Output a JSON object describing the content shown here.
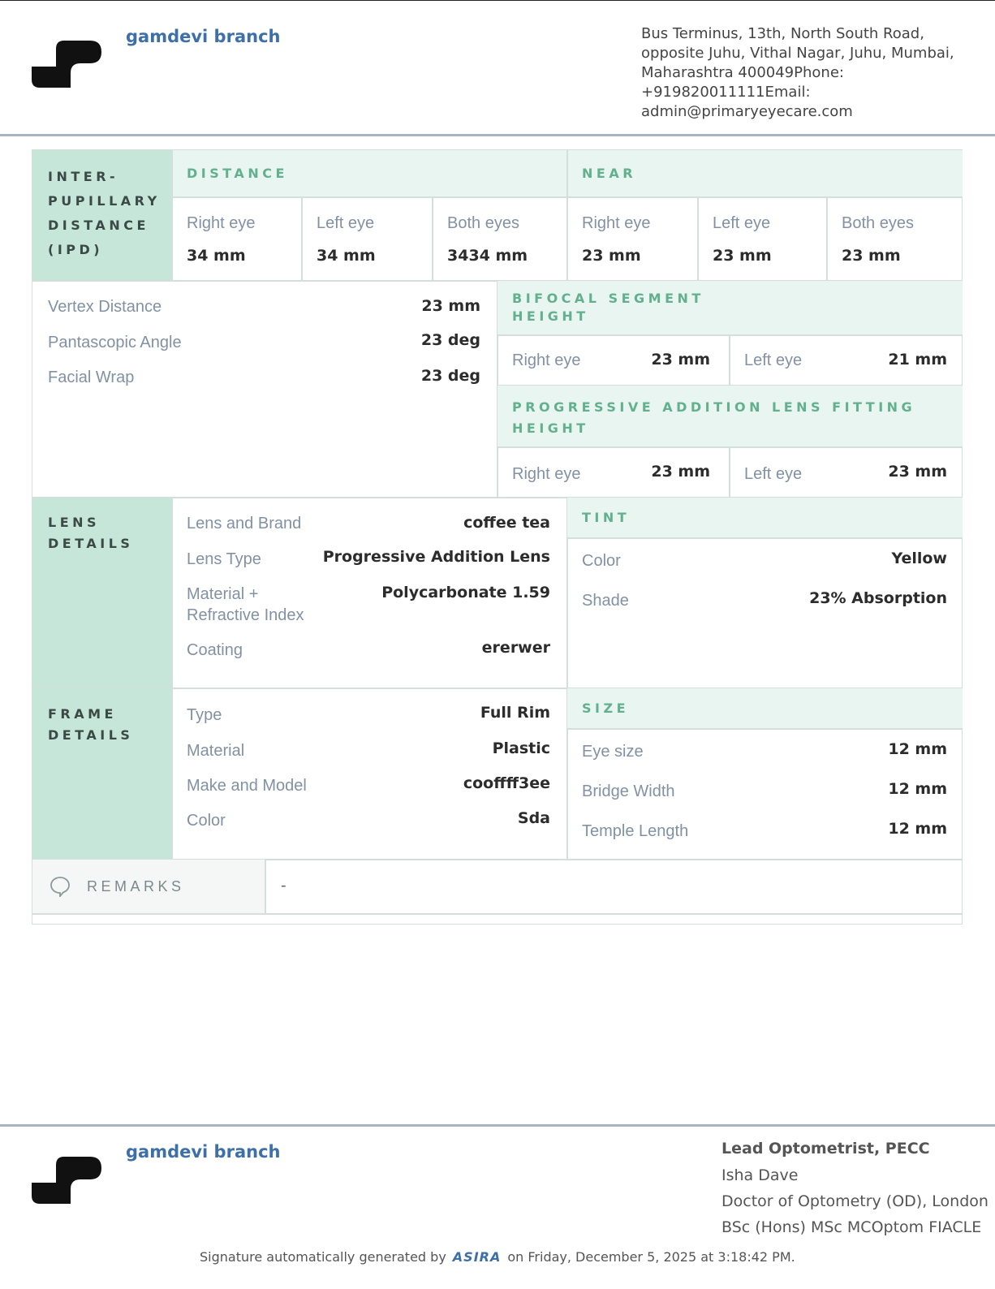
{
  "header": {
    "branch": "gamdevi branch",
    "address": "Bus Terminus, 13th, North South Road, opposite Juhu, Vithal Nagar, Juhu, Mumbai, Maharashtra 400049Phone: +919820011111Email: admin@primaryeyecare.com"
  },
  "ipd": {
    "title": "INTER-PUPILLARY DISTANCE (IPD)",
    "distance_title": "DISTANCE",
    "near_title": "NEAR",
    "distance": [
      {
        "label": "Right eye",
        "value": "34 mm"
      },
      {
        "label": "Left eye",
        "value": "34 mm"
      },
      {
        "label": "Both eyes",
        "value": "3434 mm"
      }
    ],
    "near": [
      {
        "label": "Right eye",
        "value": "23 mm"
      },
      {
        "label": "Left eye",
        "value": "23 mm"
      },
      {
        "label": "Both eyes",
        "value": "23 mm"
      }
    ]
  },
  "measurements": [
    {
      "label": "Vertex Distance",
      "value": "23 mm"
    },
    {
      "label": "Pantascopic Angle",
      "value": "23 deg"
    },
    {
      "label": "Facial Wrap",
      "value": "23 deg"
    }
  ],
  "bifocal": {
    "title": "BIFOCAL SEGMENT HEIGHT",
    "right_label": "Right eye",
    "right_value": "23 mm",
    "left_label": "Left eye",
    "left_value": "21 mm"
  },
  "progressive": {
    "title": "PROGRESSIVE ADDITION LENS FITTING HEIGHT",
    "right_label": "Right eye",
    "right_value": "23 mm",
    "left_label": "Left eye",
    "left_value": "23 mm"
  },
  "lens": {
    "title": "LENS DETAILS",
    "rows": [
      {
        "label": "Lens and Brand",
        "value": "coffee tea"
      },
      {
        "label": "Lens Type",
        "value": "Progressive Addition Lens"
      },
      {
        "label": "Material + Refractive Index",
        "value": "Polycarbonate 1.59"
      },
      {
        "label": "Coating",
        "value": "ererwer"
      }
    ],
    "tint_title": "TINT",
    "tint": [
      {
        "label": "Color",
        "value": "Yellow"
      },
      {
        "label": "Shade",
        "value": "23% Absorption"
      }
    ]
  },
  "frame": {
    "title": "FRAME DETAILS",
    "rows": [
      {
        "label": "Type",
        "value": "Full Rim"
      },
      {
        "label": "Material",
        "value": "Plastic"
      },
      {
        "label": "Make and Model",
        "value": "cooffff3ee"
      },
      {
        "label": "Color",
        "value": "Sda"
      }
    ],
    "size_title": "SIZE",
    "size": [
      {
        "label": "Eye size",
        "value": "12 mm"
      },
      {
        "label": "Bridge Width",
        "value": "12 mm"
      },
      {
        "label": "Temple Length",
        "value": "12 mm"
      }
    ]
  },
  "remarks": {
    "title": "REMARKS",
    "value": "-"
  },
  "footer": {
    "branch": "gamdevi branch",
    "signatory_title": "Lead Optometrist, PECC",
    "signatory_name": "Isha Dave",
    "signatory_line1": "Doctor of Optometry (OD), London",
    "signatory_line2": "BSc (Hons) MSc MCOptom FIACLE",
    "generated_prefix": "Signature automatically generated by",
    "generated_brand": "ASIRA",
    "generated_suffix": "on Friday, December 5, 2025 at 3:18:42 PM."
  },
  "colors": {
    "accent": "#63b08e",
    "band_dark": "#c7e6da",
    "band_light": "#e8f5f0",
    "brand_blue": "#3d6fa8"
  }
}
